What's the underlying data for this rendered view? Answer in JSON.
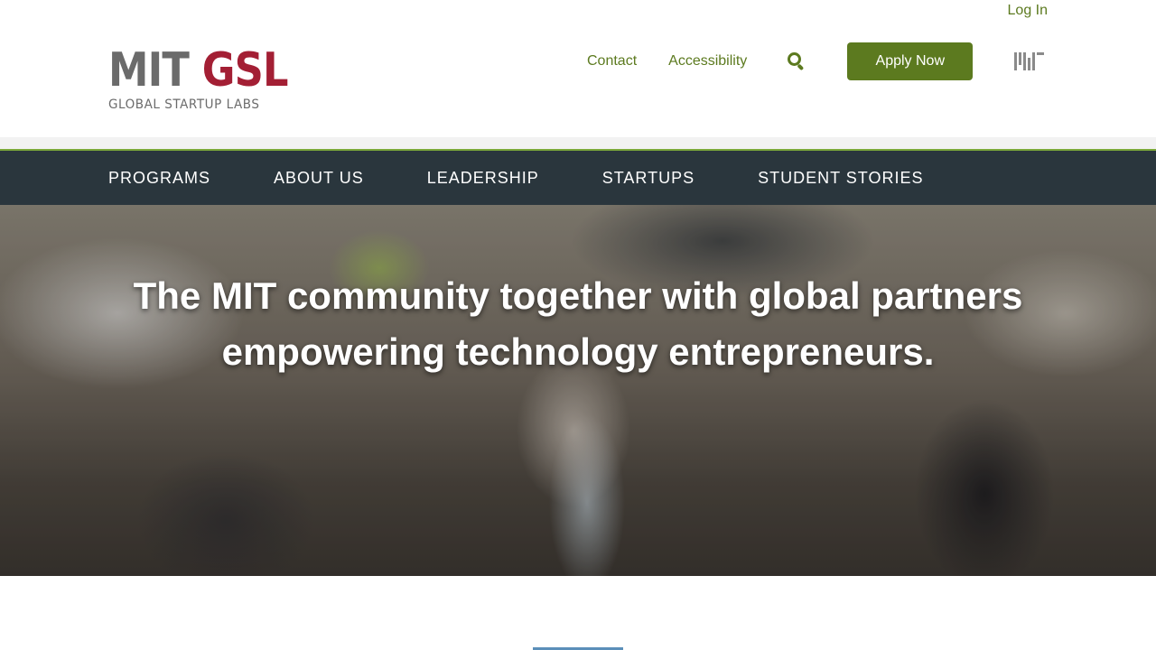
{
  "header": {
    "login_label": "Log In",
    "logo": {
      "main_mit": "MIT",
      "main_gsl": "GSL",
      "subtitle": "GLOBAL STARTUP LABS"
    },
    "util_links": {
      "contact": "Contact",
      "accessibility": "Accessibility"
    },
    "search_icon": "search-icon",
    "apply_label": "Apply Now",
    "mit_mark_icon": "mit-logo-icon"
  },
  "nav": {
    "items": [
      {
        "label": "PROGRAMS"
      },
      {
        "label": "ABOUT US"
      },
      {
        "label": "LEADERSHIP"
      },
      {
        "label": "STARTUPS"
      },
      {
        "label": "STUDENT STORIES"
      }
    ]
  },
  "hero": {
    "line1": "The MIT community together with global partners",
    "line2": "empowering technology entrepreneurs."
  },
  "colors": {
    "accent_green": "#5c7a1f",
    "nav_bg": "#2a363d",
    "nav_border": "#7ba83a",
    "logo_red": "#a31f34",
    "logo_gray": "#6b6b6b"
  }
}
